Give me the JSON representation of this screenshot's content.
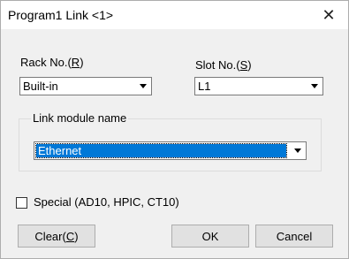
{
  "window": {
    "title": "Program1  Link <1>"
  },
  "rack": {
    "label_prefix": "Rack No.(",
    "label_key": "R",
    "label_suffix": ")",
    "value": "Built-in"
  },
  "slot": {
    "label_prefix": "Slot No.(",
    "label_key": "S",
    "label_suffix": ")",
    "value": "L1"
  },
  "link_module": {
    "group_label": "Link module name",
    "value": "Ethernet"
  },
  "special": {
    "label": "Special (AD10, HPIC, CT10)",
    "checked": false
  },
  "buttons": {
    "clear_prefix": "Clear(",
    "clear_key": "C",
    "clear_suffix": ")",
    "ok": "OK",
    "cancel": "Cancel"
  }
}
